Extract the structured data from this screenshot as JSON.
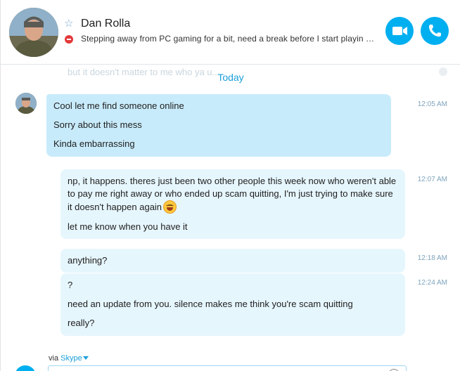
{
  "header": {
    "contact_name": "Dan Rolla",
    "mood_message": "Stepping away from PC gaming for a bit, need a break before I start playin c...",
    "favorite_icon": "star-icon",
    "status_icon": "do-not-disturb-icon",
    "video_call_icon": "video-camera-icon",
    "audio_call_icon": "phone-icon"
  },
  "conversation": {
    "faded_text": "but it doesn't matter to me who ya u...",
    "date_divider": "Today",
    "messages": [
      {
        "direction": "incoming",
        "time": "12:05 AM",
        "lines": [
          "Cool let me find someone online",
          "Sorry about this mess",
          "Kinda embarrassing"
        ]
      },
      {
        "direction": "outgoing",
        "time": "12:07 AM",
        "lines": [
          "np, it happens. theres just been two other people this week now who weren't able to pay me right away or who ended up scam quitting, I'm just trying to make sure it doesn't happen again",
          "let me know when you have it"
        ]
      },
      {
        "direction": "outgoing",
        "time": "12:18 AM",
        "lines": [
          "anything?"
        ]
      },
      {
        "direction": "outgoing",
        "time": "12:24 AM",
        "lines": [
          "?",
          "need an update from you. silence makes me think you're scam quitting",
          "really?"
        ]
      }
    ]
  },
  "compose": {
    "via_label": "via",
    "via_service": "Skype"
  },
  "colors": {
    "accent": "#00aff0",
    "incoming_bubble": "#c8ebfb",
    "outgoing_bubble": "#e6f6fd",
    "timestamp": "#7ea4bd",
    "dnd_status": "#e23a3a"
  }
}
